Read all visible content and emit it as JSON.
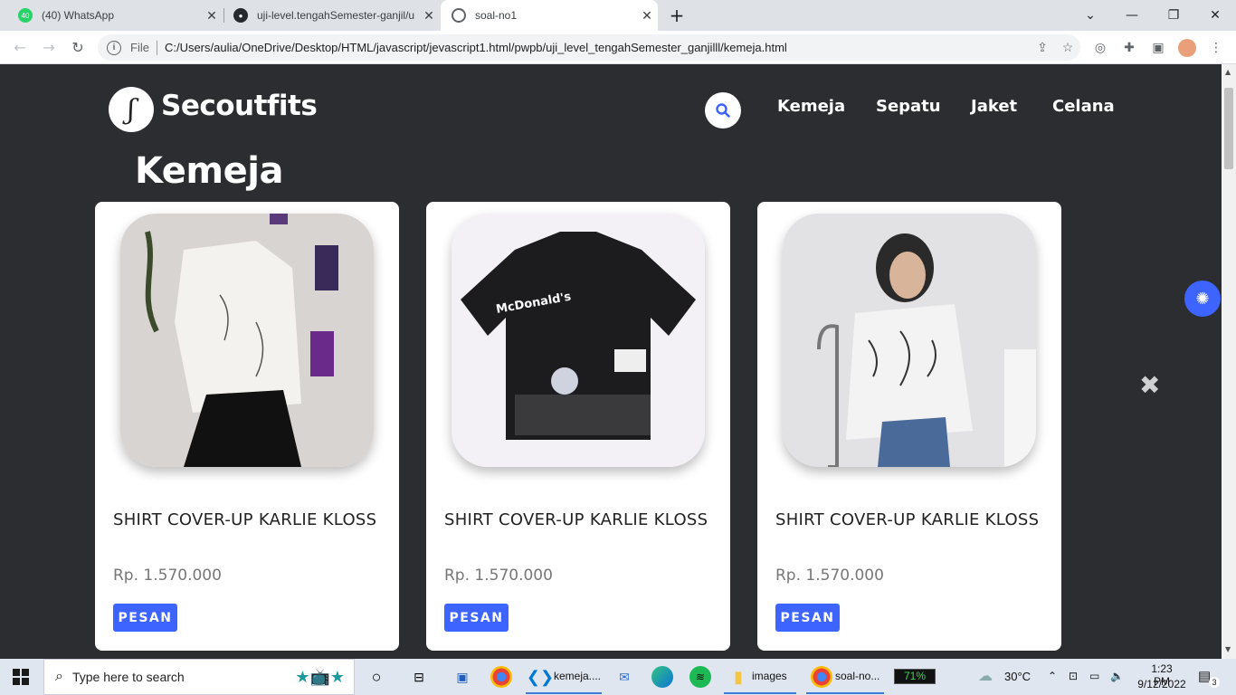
{
  "browser": {
    "tabs": [
      {
        "title": "(40) WhatsApp",
        "badge": "40"
      },
      {
        "title": "uji-level.tengahSemester-ganjil/u"
      },
      {
        "title": "soal-no1"
      }
    ],
    "new_tab": "+",
    "address": {
      "file_label": "File",
      "url": "C:/Users/aulia/OneDrive/Desktop/HTML/javascript/jevascript1.html/pwpb/uji_level_tengahSemester_ganjilll/kemeja.html"
    }
  },
  "site": {
    "brand": "Secoutfits",
    "nav": [
      "Kemeja",
      "Sepatu",
      "Jaket",
      "Celana"
    ],
    "heading": "Kemeja",
    "products": [
      {
        "name": "SHIRT COVER-UP KARLIE KLOSS",
        "price": "Rp. 1.570.000",
        "button": "PESAN"
      },
      {
        "name": "SHIRT COVER-UP KARLIE KLOSS",
        "price": "Rp. 1.570.000",
        "button": "PESAN"
      },
      {
        "name": "SHIRT COVER-UP KARLIE KLOSS",
        "price": "Rp. 1.570.000",
        "button": "PESAN"
      }
    ],
    "close_symbol": "✖"
  },
  "taskbar": {
    "search_placeholder": "Type here to search",
    "apps": [
      "kemeja....",
      "images",
      "soal-no..."
    ],
    "battery": "71%",
    "weather": "30°C",
    "time": "1:23 PM",
    "date": "9/12/2022",
    "notification_count": "3"
  },
  "colors": {
    "page_bg": "#2b2d31",
    "accent": "#3e64ff"
  }
}
